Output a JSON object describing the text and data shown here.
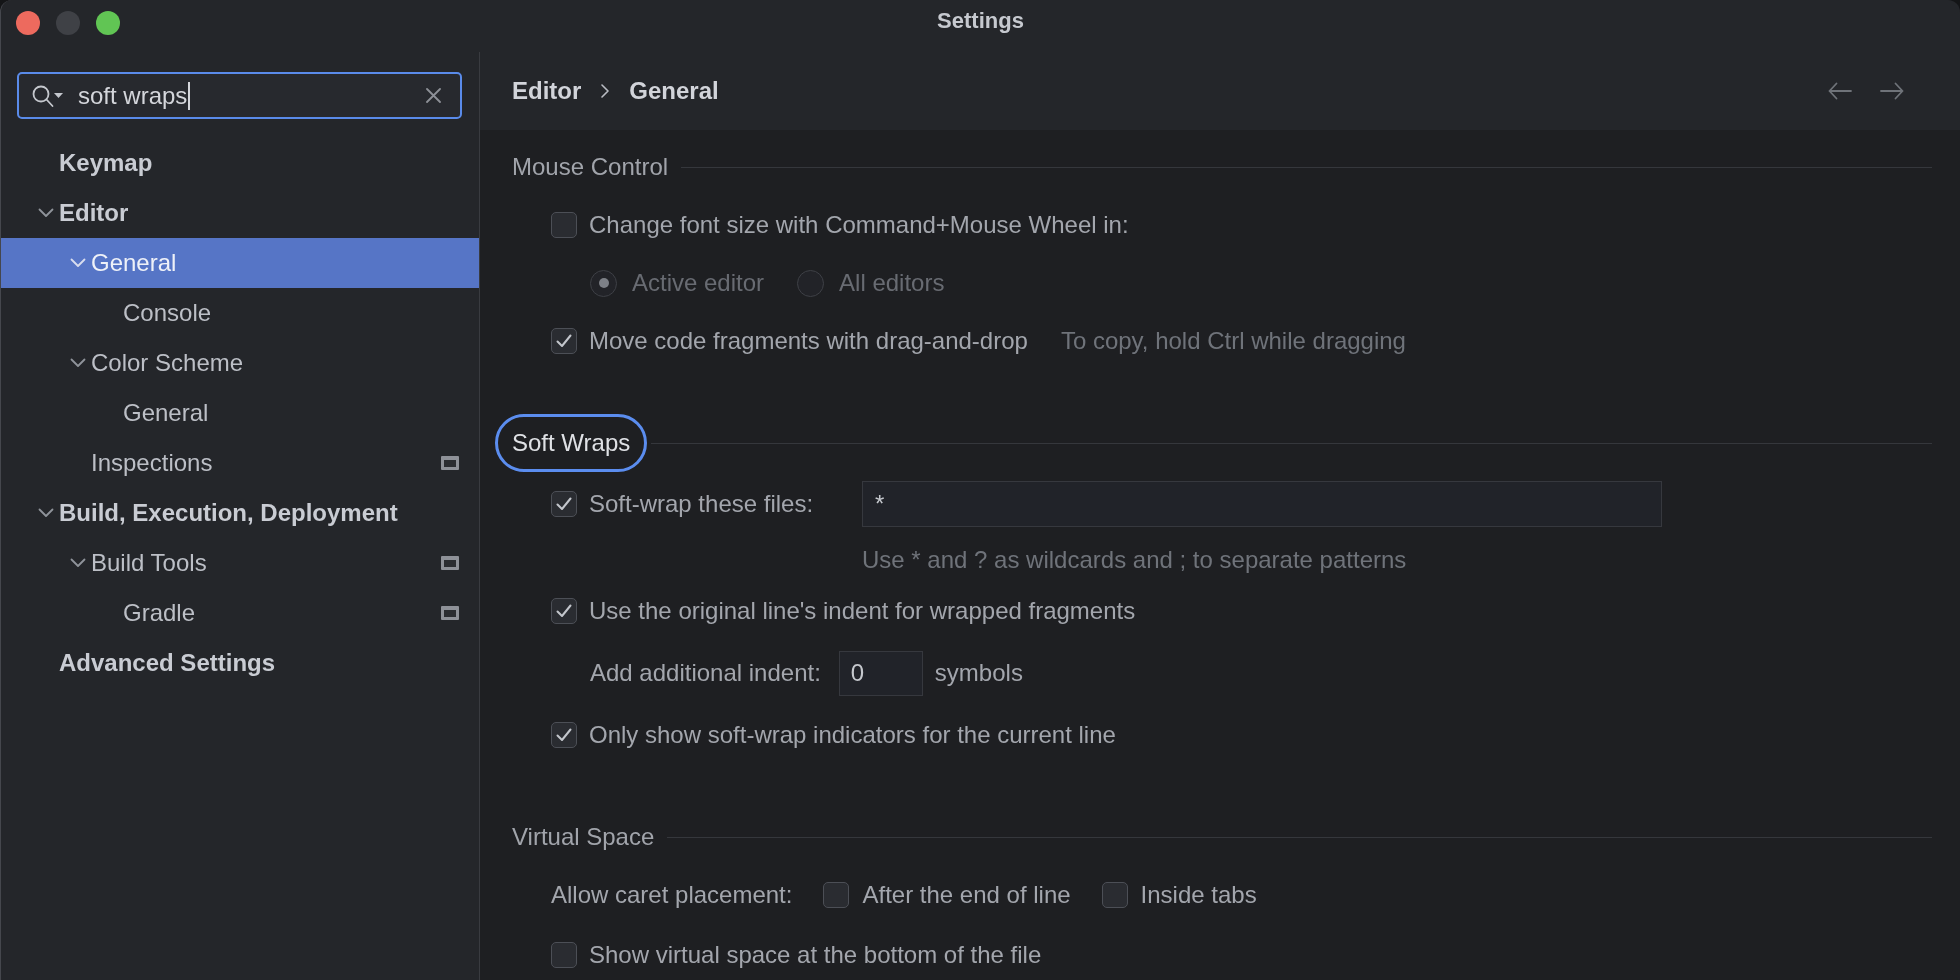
{
  "window": {
    "title": "Settings"
  },
  "sidebar": {
    "search": {
      "value": "soft wraps"
    },
    "tree": [
      {
        "label": "Keymap",
        "selected": false,
        "project_level": false
      },
      {
        "label": "Editor",
        "selected": false,
        "project_level": false,
        "expanded": true,
        "children": [
          {
            "label": "General",
            "selected": true,
            "project_level": false,
            "expanded": true,
            "children": [
              {
                "label": "Console",
                "selected": false,
                "project_level": false
              }
            ]
          },
          {
            "label": "Color Scheme",
            "selected": false,
            "project_level": false,
            "expanded": true,
            "children": [
              {
                "label": "General",
                "selected": false,
                "project_level": false
              }
            ]
          },
          {
            "label": "Inspections",
            "selected": false,
            "project_level": true
          }
        ]
      },
      {
        "label": "Build, Execution, Deployment",
        "selected": false,
        "project_level": false,
        "expanded": true,
        "children": [
          {
            "label": "Build Tools",
            "selected": false,
            "project_level": true,
            "expanded": true,
            "children": [
              {
                "label": "Gradle",
                "selected": false,
                "project_level": true
              }
            ]
          }
        ]
      },
      {
        "label": "Advanced Settings",
        "selected": false,
        "project_level": false
      }
    ]
  },
  "content": {
    "breadcrumb": [
      "Editor",
      "General"
    ],
    "sections": [
      {
        "title": "Mouse Control",
        "highlighted": false,
        "rows": [
          {
            "kind": "checkbox",
            "label": "Change font size with Command+Mouse Wheel in:",
            "checked": false
          },
          {
            "kind": "radio_group",
            "disabled": true,
            "options": [
              {
                "label": "Active editor",
                "selected": true
              },
              {
                "label": "All editors",
                "selected": false
              }
            ]
          },
          {
            "kind": "checkbox",
            "label": "Move code fragments with drag-and-drop",
            "checked": true,
            "note": "To copy, hold Ctrl while dragging"
          }
        ]
      },
      {
        "title": "Soft Wraps",
        "highlighted": true,
        "rows": [
          {
            "kind": "checkbox_field",
            "label": "Soft-wrap these files:",
            "checked": true,
            "value": "*",
            "hint": "Use * and ? as wildcards and ; to separate patterns"
          },
          {
            "kind": "checkbox",
            "label": "Use the original line's indent for wrapped fragments",
            "checked": true
          },
          {
            "kind": "number_field",
            "label": "Add additional indent:",
            "value": "0",
            "unit": "symbols"
          },
          {
            "kind": "checkbox",
            "label": "Only show soft-wrap indicators for the current line",
            "checked": true
          }
        ]
      },
      {
        "title": "Virtual Space",
        "highlighted": false,
        "rows": [
          {
            "kind": "checkbox_group",
            "label": "Allow caret placement:",
            "options": [
              {
                "label": "After the end of line",
                "checked": false
              },
              {
                "label": "Inside tabs",
                "checked": false
              }
            ]
          },
          {
            "kind": "checkbox",
            "label": "Show virtual space at the bottom of the file",
            "checked": false
          }
        ]
      }
    ]
  }
}
